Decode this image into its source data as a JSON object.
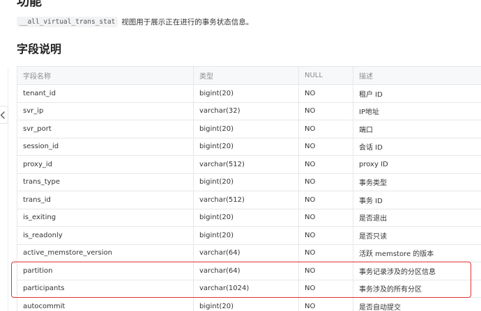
{
  "section": {
    "title": "功能",
    "code": "__all_virtual_trans_stat",
    "description": "视图用于展示正在进行的事务状态信息。"
  },
  "fields_section": {
    "title": "字段说明"
  },
  "table": {
    "headers": [
      "字段名称",
      "类型",
      "NULL",
      "描述"
    ],
    "rows": [
      [
        "tenant_id",
        "bigint(20)",
        "NO",
        "租户 ID"
      ],
      [
        "svr_ip",
        "varchar(32)",
        "NO",
        "IP地址"
      ],
      [
        "svr_port",
        "bigint(20)",
        "NO",
        "端口"
      ],
      [
        "session_id",
        "bigint(20)",
        "NO",
        "会话 ID"
      ],
      [
        "proxy_id",
        "varchar(512)",
        "NO",
        "proxy ID"
      ],
      [
        "trans_type",
        "bigint(20)",
        "NO",
        "事务类型"
      ],
      [
        "trans_id",
        "varchar(512)",
        "NO",
        "事务 ID"
      ],
      [
        "is_exiting",
        "bigint(20)",
        "NO",
        "是否退出"
      ],
      [
        "is_readonly",
        "bigint(20)",
        "NO",
        "是否只读"
      ],
      [
        "active_memstore_version",
        "varchar(64)",
        "NO",
        "活跃 memstore 的版本"
      ],
      [
        "partition",
        "varchar(64)",
        "NO",
        "事务记录涉及的分区信息"
      ],
      [
        "participants",
        "varchar(1024)",
        "NO",
        "事务涉及的所有分区"
      ],
      [
        "autocommit",
        "bigint(20)",
        "NO",
        "是否自动提交"
      ]
    ]
  },
  "sidebar_toggle": {
    "icon": "chevron-left-icon"
  },
  "colors": {
    "highlight_border": "#e03131",
    "header_background": "#f7f8fa",
    "grid_line": "#e5e7eb"
  }
}
